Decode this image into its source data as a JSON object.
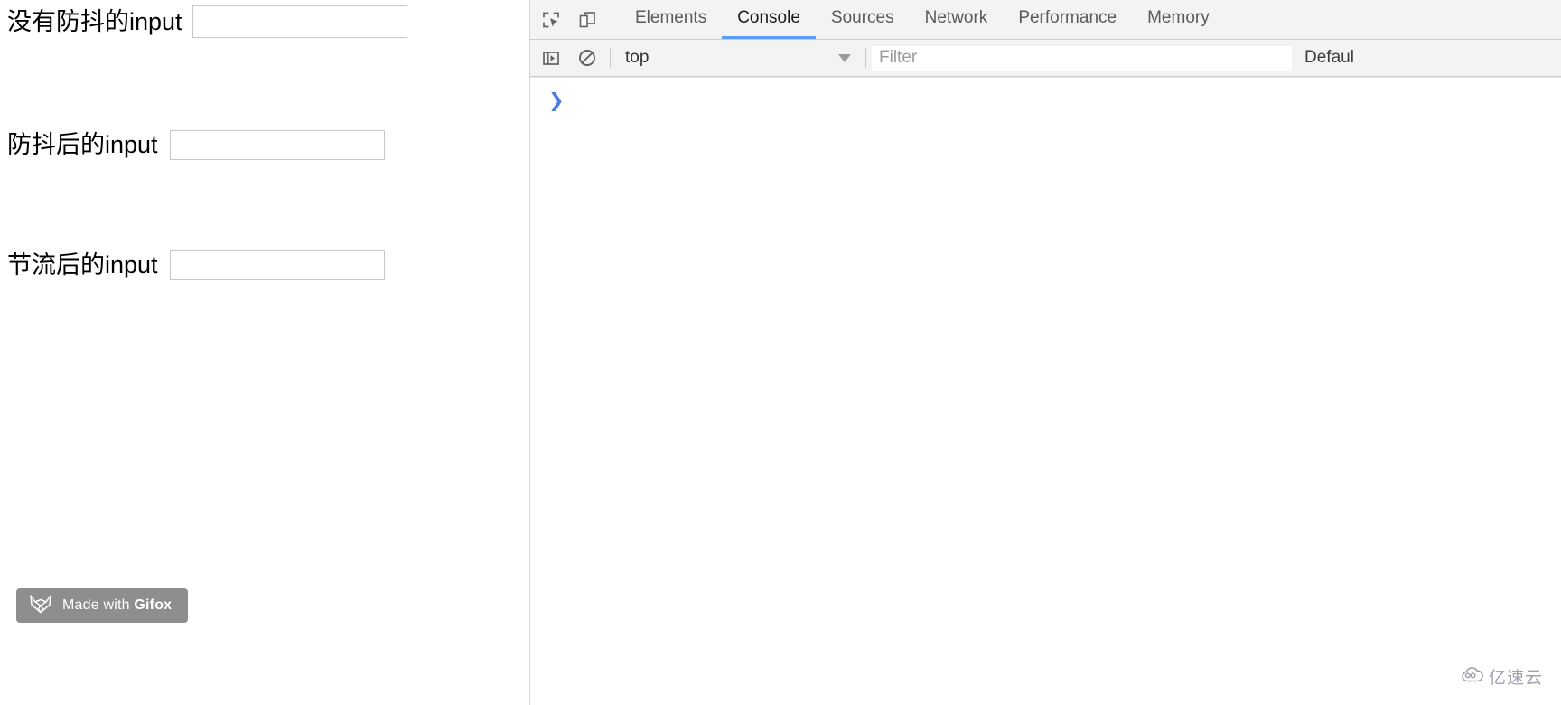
{
  "page": {
    "form_rows": [
      {
        "label": "没有防抖的input",
        "value": "",
        "placeholder": ""
      },
      {
        "label": "防抖后的input",
        "value": "",
        "placeholder": ""
      },
      {
        "label": "节流后的input",
        "value": "",
        "placeholder": ""
      }
    ],
    "gifox_badge": {
      "prefix": "Made with ",
      "brand": "Gifox",
      "icon": "fox-head-icon",
      "background": "#8e8e8e"
    }
  },
  "devtools": {
    "toolbar_icons": [
      {
        "name": "inspect-element-icon"
      },
      {
        "name": "device-toolbar-icon"
      }
    ],
    "tabs": [
      {
        "label": "Elements",
        "active": false
      },
      {
        "label": "Console",
        "active": true
      },
      {
        "label": "Sources",
        "active": false
      },
      {
        "label": "Network",
        "active": false
      },
      {
        "label": "Performance",
        "active": false
      },
      {
        "label": "Memory",
        "active": false
      }
    ],
    "active_tab_underline_color": "#5a9cf8",
    "filter_bar": {
      "sidebar_toggle_icon": "console-sidebar-toggle-icon",
      "clear_console_icon": "clear-console-icon",
      "context": "top",
      "context_caret": "chevron-down-icon",
      "filter_value": "",
      "filter_placeholder": "Filter",
      "level": "Defaul"
    },
    "console": {
      "prompt": "❯",
      "input_value": ""
    }
  },
  "watermark": {
    "icon": "cloud-logo-icon",
    "text": "亿速云"
  }
}
